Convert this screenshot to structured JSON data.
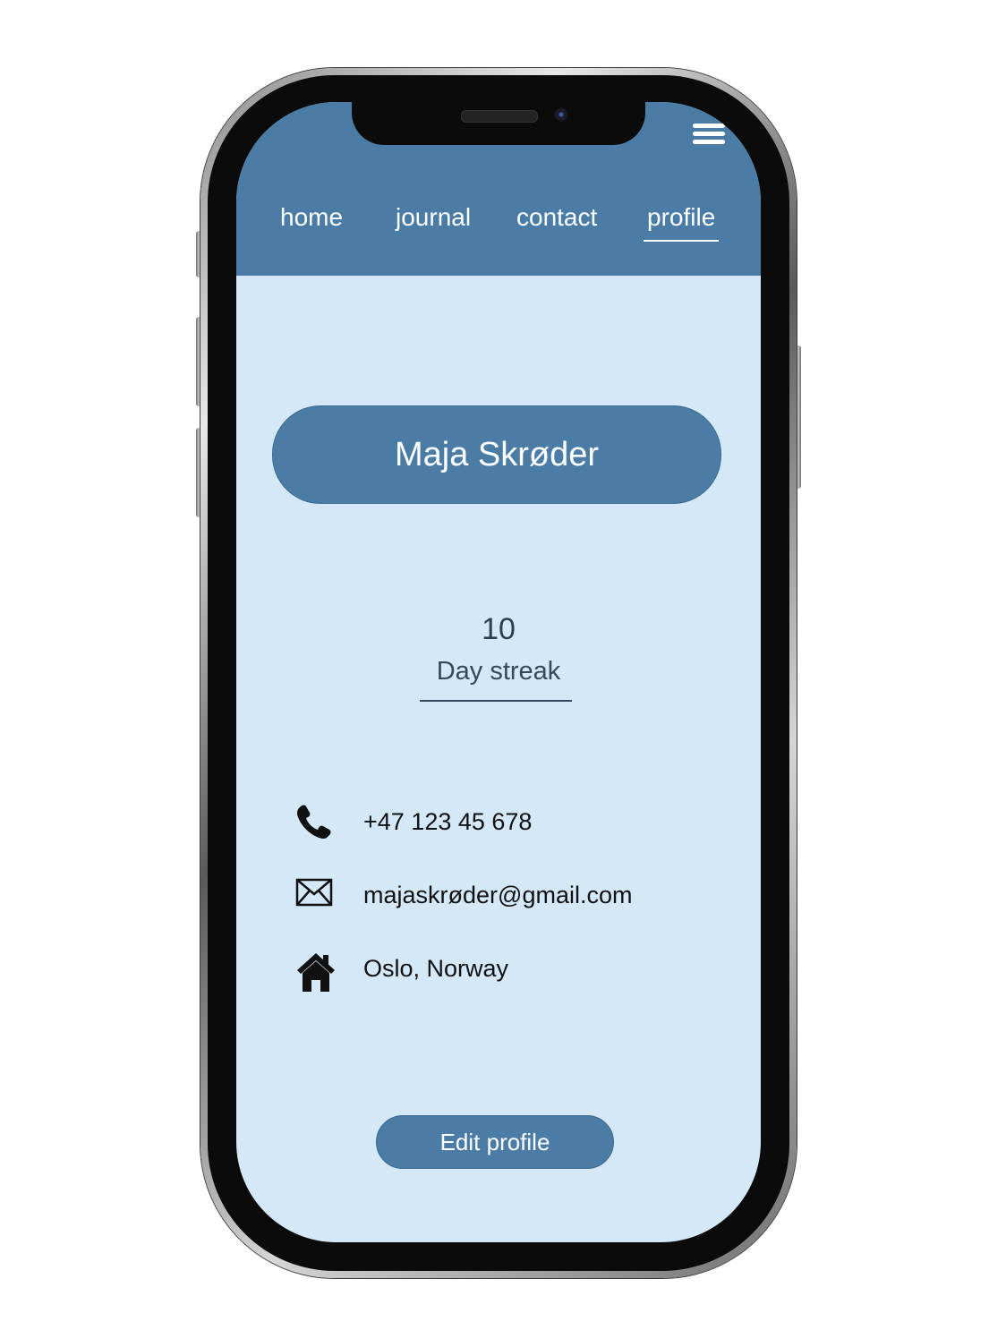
{
  "nav": {
    "items": [
      {
        "label": "home"
      },
      {
        "label": "journal"
      },
      {
        "label": "contact"
      },
      {
        "label": "profile",
        "active": true
      }
    ],
    "menu_icon": "hamburger-menu-icon"
  },
  "profile": {
    "name": "Maja Skrøder",
    "streak_count": "10",
    "streak_label": "Day streak",
    "contact": {
      "phone": "+47 123 45 678",
      "email": "majaskrøder@gmail.com",
      "location": "Oslo, Norway"
    },
    "icons": {
      "phone": "phone-icon",
      "email": "envelope-icon",
      "location": "home-icon"
    },
    "edit_button_label": "Edit profile"
  },
  "colors": {
    "header": "#4a7ca5",
    "background": "#d4e8f8",
    "accent": "#4a7ca5",
    "text_dark": "#2e3e4e"
  }
}
